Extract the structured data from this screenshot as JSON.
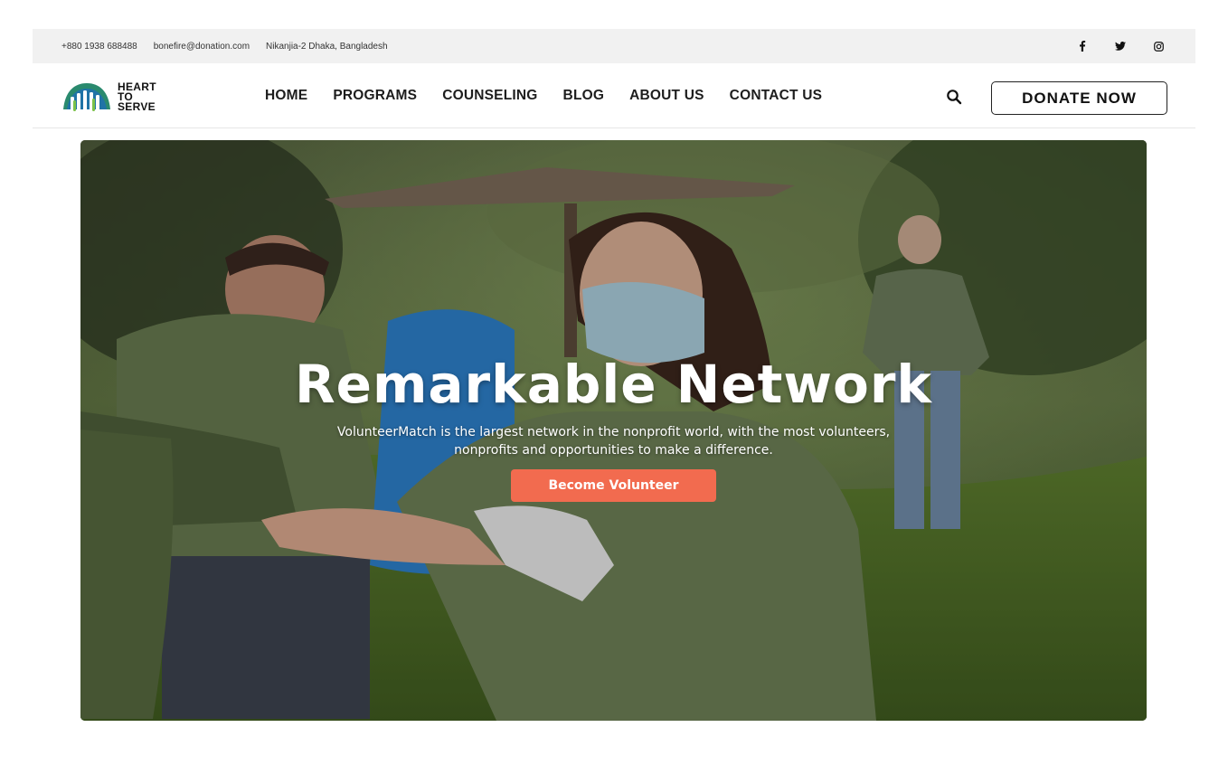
{
  "topbar": {
    "phone": "+880 1938 688488",
    "email": "bonefire@donation.com",
    "address": "Nikanjia-2 Dhaka, Bangladesh",
    "socials": [
      {
        "icon": "facebook-icon",
        "glyph": "f"
      },
      {
        "icon": "twitter-icon",
        "glyph": "t"
      },
      {
        "icon": "instagram-icon",
        "glyph": "i"
      }
    ]
  },
  "logo": {
    "line1": "HEART",
    "line2": "TO",
    "line3": "SERVE"
  },
  "nav": {
    "items": [
      "HOME",
      "PROGRAMS",
      "COUNSELING",
      "BLOG",
      "ABOUT US",
      "CONTACT US"
    ]
  },
  "header": {
    "search_icon": "search-icon",
    "donate_label": "DONATE NOW"
  },
  "hero": {
    "title": "Remarkable Network",
    "subtitle": "VolunteerMatch is the largest network in the nonprofit world, with the most volunteers, nonprofits and opportunities to make a difference.",
    "cta_label": "Become Volunteer",
    "cta_color": "#f26b4f"
  }
}
